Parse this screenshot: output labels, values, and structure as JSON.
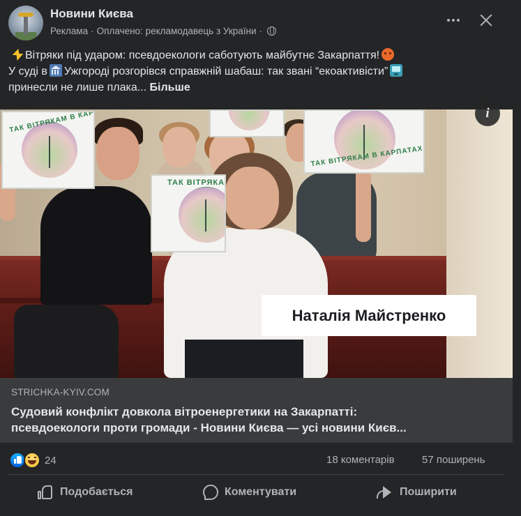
{
  "header": {
    "page_name": "Новини Києва",
    "sponsored": "Реклама",
    "separator": "·",
    "paid_by": "Оплачено: рекламодавець з України",
    "separator2": "·"
  },
  "post": {
    "line1": "Вітряки під ударом: псевдоекологи саботують майбутнє Закарпаття!",
    "line2_a": "У суді в",
    "line2_b": "Ужгороді розгорівся справжній шабаш: так звані “екоактивісти”",
    "line3": "принесли не лише плака...",
    "more_label": "Більше"
  },
  "media": {
    "caption": "Наталія Майстренко",
    "info_label": "i",
    "sign_text_1": "ТАК ВІТРЯКАМ В КАРПАТАХ",
    "sign_text_2": "ТАК ВІТРЯКАМ В КАРПАТАХ",
    "sign_text_3": "ТАК ВІТРЯКАМ"
  },
  "link_preview": {
    "domain": "STRICHKA-KYIV.COM",
    "title_line1": "Судовий конфлікт довкола вітроенергетики на Закарпатті:",
    "title_line2": "псевдоекологи проти громади - Новини Києва — усі новини Києв..."
  },
  "stats": {
    "reactions_count": "24",
    "comments": "18 коментарів",
    "shares": "57 поширень"
  },
  "actions": {
    "like_label": "Подобається",
    "comment_label": "Коментувати",
    "share_label": "Поширити"
  },
  "icons": {
    "avatar": "page-avatar",
    "globe": "globe-icon",
    "more": "more-horizontal-icon",
    "close": "close-icon",
    "zap": "high-voltage-emoji",
    "angry": "angry-face-emoji",
    "bank": "bank-emoji",
    "tv": "television-emoji",
    "info": "info-icon",
    "like": "like-reaction-icon",
    "haha": "haha-reaction-icon",
    "thumb": "thumbs-up-icon",
    "comment": "comment-icon",
    "share": "share-icon"
  },
  "colors": {
    "background": "#242526",
    "link_preview_bg": "#3a3b3c",
    "primary_text": "#e4e6eb",
    "secondary_text": "#b0b3b8",
    "like_blue": "#1877f2"
  }
}
